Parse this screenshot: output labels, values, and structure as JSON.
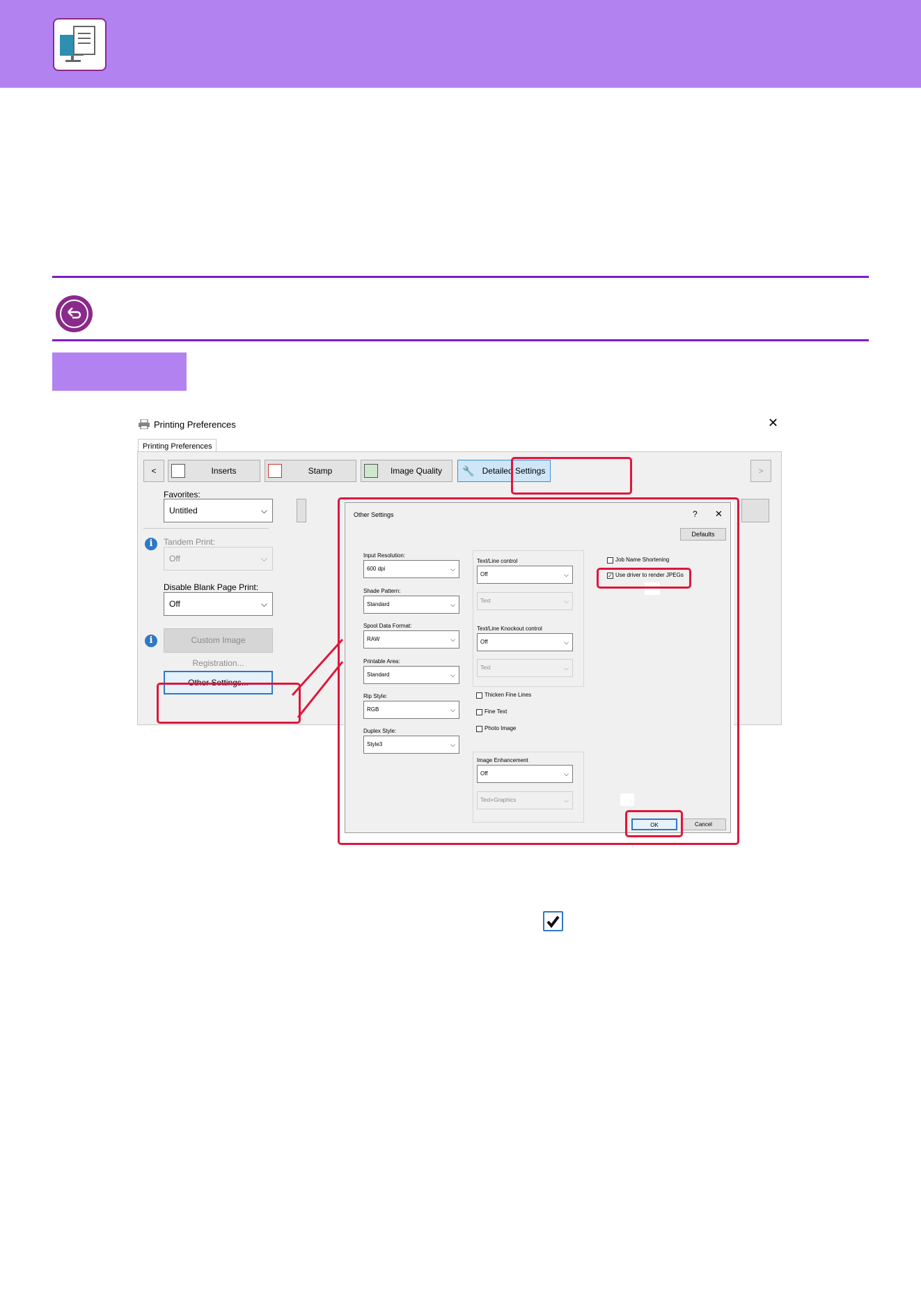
{
  "header": {
    "icon": "monitor-document-icon",
    "color": "#b283f0"
  },
  "back_icon": "back-arrow-icon",
  "printing_preferences": {
    "title": "Printing Preferences",
    "close": "✕",
    "tab": "Printing Preferences",
    "nav_prev": "<",
    "nav_next": ">",
    "features": [
      {
        "label": "Inserts",
        "icon": "inserts-icon"
      },
      {
        "label": "Stamp",
        "icon": "stamp-icon"
      },
      {
        "label": "Image Quality",
        "icon": "image-quality-icon"
      },
      {
        "label": "Detailed Settings",
        "icon": "wrench-icon"
      }
    ],
    "favorites": {
      "label": "Favorites:",
      "value": "Untitled"
    },
    "tandem_print": {
      "label": "Tandem Print:",
      "value": "Off"
    },
    "disable_blank_page_print": {
      "label": "Disable Blank Page Print:",
      "value": "Off"
    },
    "custom_image_registration": "Custom Image Registration...",
    "other_settings": "Other Settings..."
  },
  "other_settings_dialog": {
    "title": "Other Settings",
    "help": "?",
    "close": "✕",
    "defaults": "Defaults",
    "input_resolution": {
      "label": "Input Resolution:",
      "value": "600 dpi"
    },
    "shade_pattern": {
      "label": "Shade Pattern:",
      "value": "Standard"
    },
    "spool_data_format": {
      "label": "Spool Data Format:",
      "value": "RAW"
    },
    "printable_area": {
      "label": "Printable Area:",
      "value": "Standard"
    },
    "rip_style": {
      "label": "Rip Style:",
      "value": "RGB"
    },
    "duplex_style": {
      "label": "Duplex Style:",
      "value": "Style3"
    },
    "text_line_control": {
      "label": "Text/Line control",
      "value": "Off",
      "sub_value": "Text"
    },
    "text_line_knockout_control": {
      "label": "Text/Line Knockout control",
      "value": "Off",
      "sub_value": "Text"
    },
    "thicken_fine_lines": {
      "label": "Thicken Fine Lines",
      "checked": false
    },
    "fine_text": {
      "label": "Fine Text",
      "checked": false
    },
    "photo_image": {
      "label": "Photo Image",
      "checked": false
    },
    "image_enhancement": {
      "label": "Image Enhancement",
      "value": "Off",
      "sub_value": "Text+Graphics"
    },
    "job_name_shortening": {
      "label": "Job Name Shortening",
      "checked": false
    },
    "use_driver_to_render_jpegs": {
      "label": "Use driver to render JPEGs",
      "checked": true
    },
    "ok": "OK",
    "cancel": "Cancel"
  },
  "checkmark_icon": "checkmark-icon",
  "highlight_color": "#e0163a"
}
